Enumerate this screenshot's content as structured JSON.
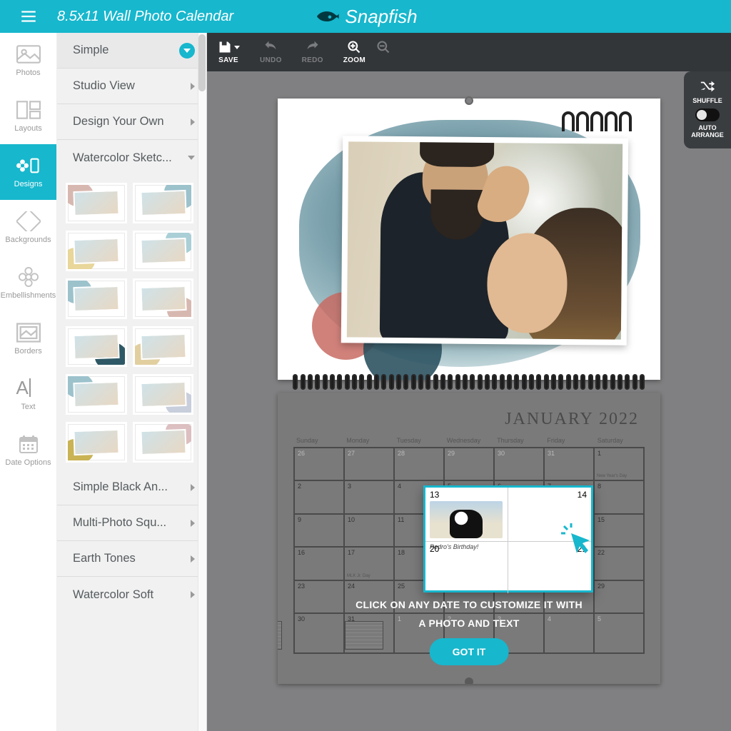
{
  "brand": "Snapfish",
  "product_title": "8.5x11 Wall Photo Calendar",
  "nav": {
    "items": [
      {
        "id": "photos",
        "label": "Photos"
      },
      {
        "id": "layouts",
        "label": "Layouts"
      },
      {
        "id": "designs",
        "label": "Designs"
      },
      {
        "id": "backgrounds",
        "label": "Backgrounds"
      },
      {
        "id": "embellishments",
        "label": "Embellishments"
      },
      {
        "id": "borders",
        "label": "Borders"
      },
      {
        "id": "text",
        "label": "Text"
      },
      {
        "id": "date",
        "label": "Date Options"
      }
    ],
    "active": "designs"
  },
  "designs_panel": {
    "dropdown": "Simple",
    "categories_top": [
      "Studio View",
      "Design Your Own"
    ],
    "active_category": "Watercolor Sketc...",
    "categories_bottom": [
      "Simple Black An...",
      "Multi-Photo Squ...",
      "Earth Tones",
      "Watercolor Soft"
    ]
  },
  "toolbar": {
    "save": "SAVE",
    "undo": "UNDO",
    "redo": "REDO",
    "zoom": "ZOOM"
  },
  "float_controls": {
    "shuffle": "SHUFFLE",
    "auto_arrange_l1": "AUTO",
    "auto_arrange_l2": "ARRANGE"
  },
  "calendar": {
    "month_title": "JANUARY 2022",
    "days_of_week": [
      "Sunday",
      "Monday",
      "Tuesday",
      "Wednesday",
      "Thursday",
      "Friday",
      "Saturday"
    ],
    "event_note": "New Year's Day",
    "mlk_note": "MLK Jr. Day",
    "highlight": {
      "d13": "13",
      "d14": "14",
      "d20": "20",
      "d21": "21",
      "caption": "Pedro's Birthday!"
    }
  },
  "tooltip": {
    "line1": "CLICK ON ANY DATE TO CUSTOMIZE IT WITH",
    "line2": "A PHOTO AND TEXT",
    "cta": "GOT IT"
  },
  "colors": {
    "teal": "#17b7cd"
  }
}
